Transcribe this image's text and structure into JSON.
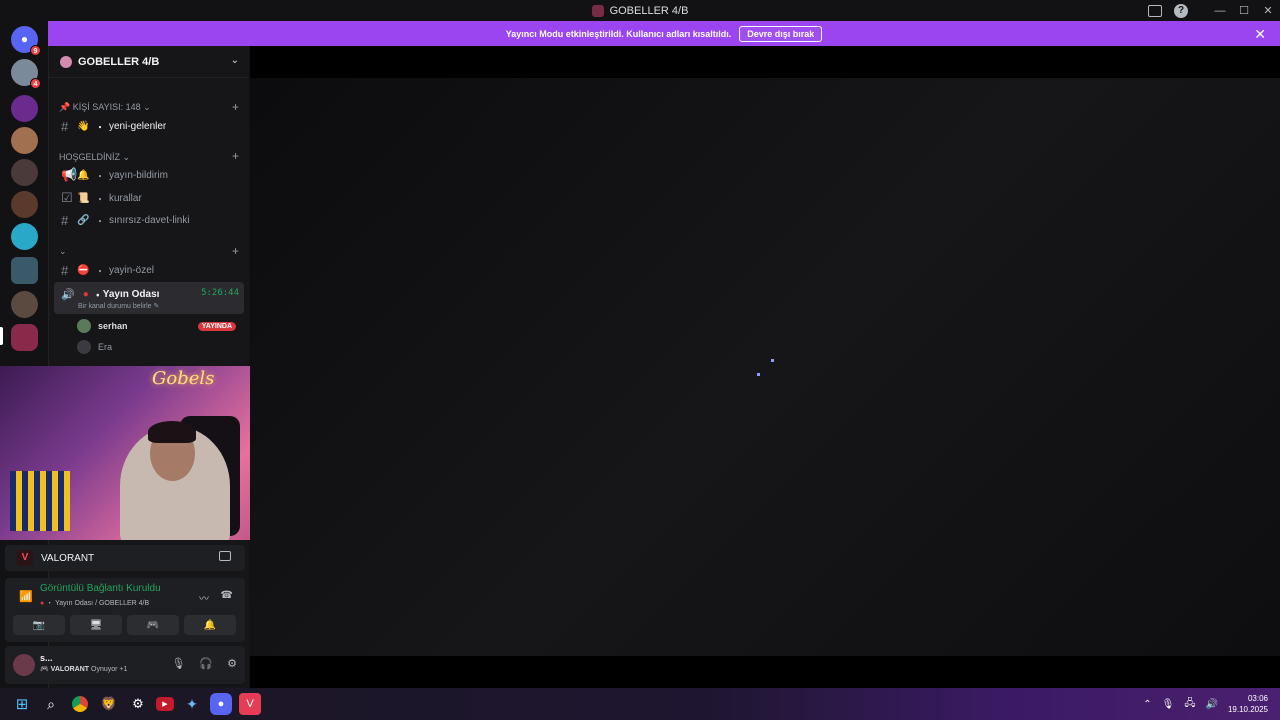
{
  "window": {
    "title": "GOBELLER 4/B"
  },
  "notice": {
    "text": "Yayıncı Modu etkinleştirildi. Kullanıcı adları kısaltıldı.",
    "button": "Devre dışı bırak"
  },
  "server_list": {
    "badges": [
      "9",
      "4"
    ]
  },
  "server": {
    "name": "GOBELLER 4/B",
    "categories": [
      {
        "label": "KİŞİ SAYISI: 148"
      },
      {
        "label": "HOŞGELDİNİZ"
      },
      {
        "label": ""
      }
    ],
    "channels": {
      "yeni_gelenler": {
        "emoji": "👋",
        "name": "yeni-gelenler"
      },
      "yayin_bildirim": {
        "emoji": "🔔",
        "name": "yayın-bildirim"
      },
      "kurallar": {
        "emoji": "📜",
        "name": "kurallar"
      },
      "davet": {
        "emoji": "🔗",
        "name": "sınırsız-davet-linki"
      },
      "yayin_ozel": {
        "emoji": "⛔",
        "name": "yayin-özel"
      }
    },
    "voice_channel": {
      "name": "Yayın Odası",
      "timer": "5:26:44",
      "status": "Bir kanal durumu belirle"
    },
    "voice_users": [
      {
        "name": "serhan",
        "badge": "YAYINDA"
      },
      {
        "name": "Era",
        "badge": ""
      }
    ]
  },
  "video": {
    "neon_text": "Gobels"
  },
  "game_activity": {
    "name": "VALORANT"
  },
  "rtc": {
    "status": "Görüntülü Bağlantı Kuruldu",
    "location": "Yayın Odası / GOBELLER 4/B"
  },
  "user_panel": {
    "name": "s...",
    "activity": "VALORANT",
    "activity_suffix": "Oynuyor +1"
  },
  "taskbar": {
    "time": "03:06",
    "date": "19.10.2025"
  }
}
